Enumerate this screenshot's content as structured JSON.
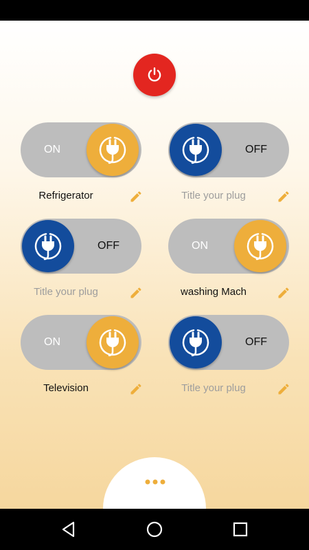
{
  "plugs": [
    {
      "state": "ON",
      "title": "Refrigerator",
      "placeholder": false
    },
    {
      "state": "OFF",
      "title": "Title your plug",
      "placeholder": true
    },
    {
      "state": "OFF",
      "title": "Title your plug",
      "placeholder": true
    },
    {
      "state": "ON",
      "title": "washing Mach",
      "placeholder": false
    },
    {
      "state": "ON",
      "title": "Television",
      "placeholder": false
    },
    {
      "state": "OFF",
      "title": "Title your plug",
      "placeholder": true
    }
  ],
  "icons": {
    "power": "power-icon",
    "plug": "plug-icon",
    "edit": "pencil-icon",
    "more": "more-dots-icon",
    "back": "back-triangle-icon",
    "home": "home-circle-icon",
    "recents": "recents-square-icon"
  },
  "colors": {
    "power_red": "#e32620",
    "on_knob": "#eeae3b",
    "off_knob": "#134c9c",
    "track": "#bdbdbd",
    "accent": "#eeae3b"
  }
}
